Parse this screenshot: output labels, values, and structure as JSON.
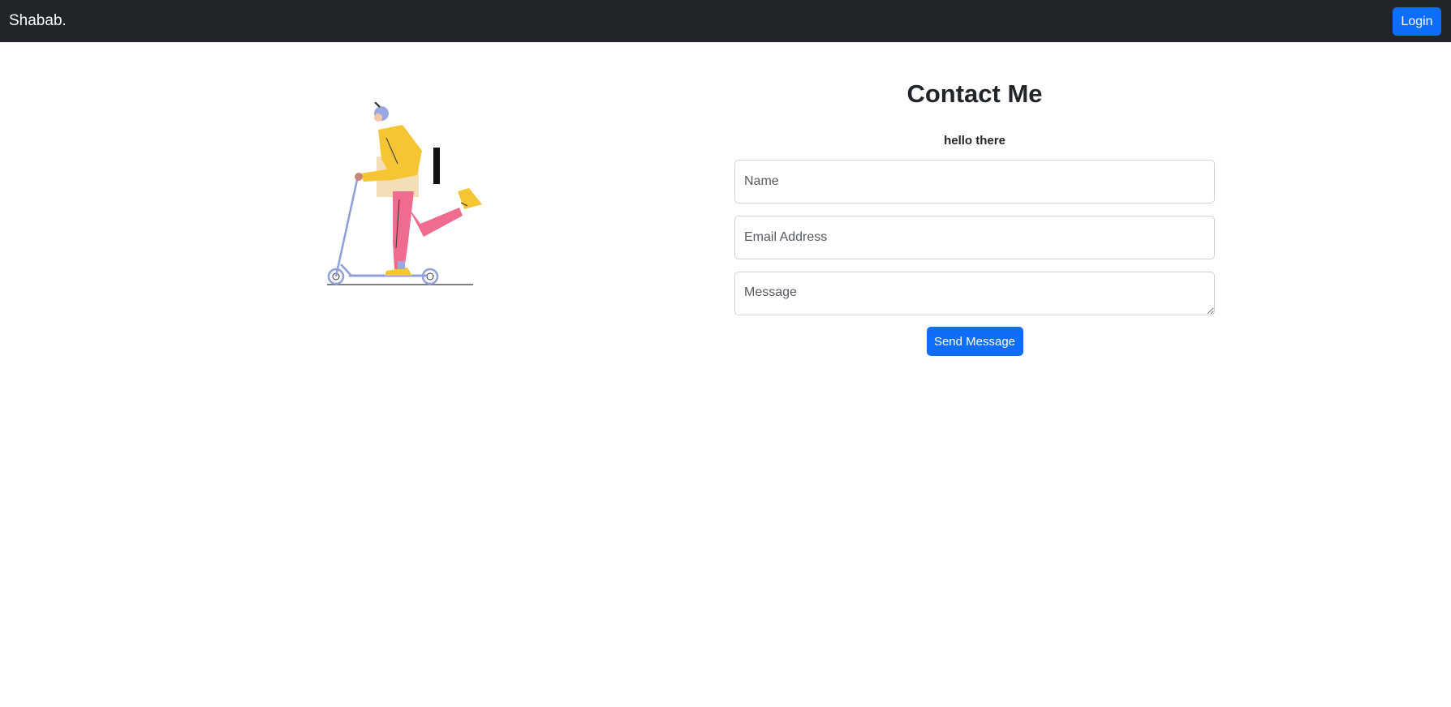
{
  "navbar": {
    "brand": "Shabab.",
    "login_label": "Login"
  },
  "contact": {
    "title": "Contact Me",
    "subtitle": "hello there",
    "name_placeholder": "Name",
    "email_placeholder": "Email Address",
    "message_placeholder": "Message",
    "send_label": "Send Message"
  },
  "illustration": {
    "subject": "person-riding-scooter-illustration"
  },
  "colors": {
    "navbar_bg": "#212529",
    "primary": "#0d6efd",
    "jacket": "#f5c534",
    "pants": "#ef6b8f",
    "scooter": "#8e9fd9",
    "box": "#f2dfb8"
  }
}
